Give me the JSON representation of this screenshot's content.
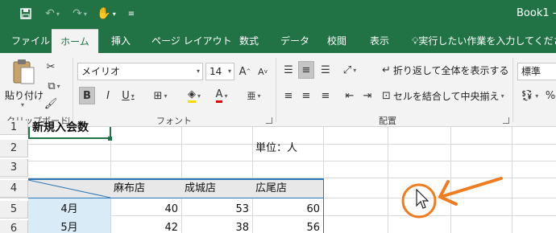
{
  "title_bar": {
    "app_title": "Book1 -"
  },
  "tabs": [
    "ファイル",
    "ホーム",
    "挿入",
    "ページ レイアウト",
    "数式",
    "データ",
    "校閲",
    "表示"
  ],
  "tell_me": "実行したい作業を入力してください",
  "ribbon": {
    "clipboard": {
      "paste_label": "貼り付け",
      "group_label": "クリップボード"
    },
    "font": {
      "font_name": "メイリオ",
      "font_size": "14",
      "group_label": "フォント",
      "bold": "B",
      "italic": "I",
      "underline": "U",
      "grow": "A",
      "shrink": "A"
    },
    "alignment": {
      "wrap_text": "折り返して全体を表示する",
      "merge_center": "セルを結合して中央揃え",
      "group_label": "配置"
    },
    "number": {
      "format": "標準"
    }
  },
  "sheet": {
    "rows": [
      "1",
      "2",
      "3",
      "4",
      "5",
      "6"
    ],
    "a1": "新規入会数",
    "unit": "単位：人",
    "headers": [
      "麻布店",
      "成城店",
      "広尾店"
    ],
    "data_rows": [
      {
        "label": "4月",
        "values": [
          "40",
          "53",
          "60"
        ]
      },
      {
        "label": "5月",
        "values": [
          "42",
          "38",
          "56"
        ]
      }
    ]
  },
  "colors": {
    "excel_green": "#217346",
    "annotation_orange": "#f07c1e",
    "header_blue": "#d9ebf7",
    "table_line": "#2a78b8"
  }
}
